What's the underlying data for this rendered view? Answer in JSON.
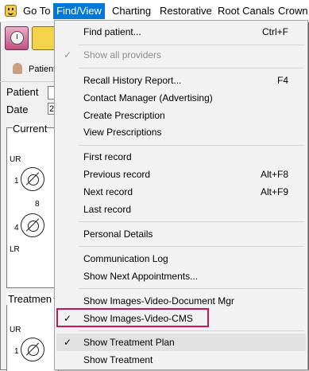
{
  "menubar": {
    "items": [
      {
        "label": "Go To"
      },
      {
        "label": "Find/View"
      },
      {
        "label": "Charting"
      },
      {
        "label": "Restorative"
      },
      {
        "label": "Root Canals"
      },
      {
        "label": "Crown"
      }
    ]
  },
  "background": {
    "patient_button": "Patient",
    "fields": {
      "patient_label": "Patient",
      "date_label": "Date",
      "date_value": "2"
    },
    "current_panel": {
      "title": "Current",
      "ur": "UR",
      "lr": "LR",
      "num1": "1",
      "num8": "8",
      "num4": "4"
    },
    "treatment_panel": {
      "title": "Treatmen",
      "ur": "UR",
      "num1": "1"
    }
  },
  "dropdown": {
    "items": [
      {
        "label": "Find patient...",
        "shortcut": "Ctrl+F",
        "checked": false,
        "disabled": false
      },
      {
        "label": "Show all providers",
        "shortcut": "",
        "checked": true,
        "disabled": true
      },
      {
        "label": "Recall History Report...",
        "shortcut": "F4",
        "checked": false,
        "disabled": false
      },
      {
        "label": "Contact Manager (Advertising)",
        "shortcut": "",
        "checked": false,
        "disabled": false
      },
      {
        "label": "Create Prescription",
        "shortcut": "",
        "checked": false,
        "disabled": false
      },
      {
        "label": "View Prescriptions",
        "shortcut": "",
        "checked": false,
        "disabled": false
      },
      {
        "label": "First record",
        "shortcut": "",
        "checked": false,
        "disabled": false
      },
      {
        "label": "Previous record",
        "shortcut": "Alt+F8",
        "checked": false,
        "disabled": false
      },
      {
        "label": "Next record",
        "shortcut": "Alt+F9",
        "checked": false,
        "disabled": false
      },
      {
        "label": "Last record",
        "shortcut": "",
        "checked": false,
        "disabled": false
      },
      {
        "label": "Personal Details",
        "shortcut": "",
        "checked": false,
        "disabled": false
      },
      {
        "label": "Communication Log",
        "shortcut": "",
        "checked": false,
        "disabled": false
      },
      {
        "label": "Show Next Appointments...",
        "shortcut": "",
        "checked": false,
        "disabled": false
      },
      {
        "label": "Show Images-Video-Document Mgr",
        "shortcut": "",
        "checked": false,
        "disabled": false
      },
      {
        "label": "Show Images-Video-CMS",
        "shortcut": "",
        "checked": true,
        "disabled": false
      },
      {
        "label": "Show Treatment Plan",
        "shortcut": "",
        "checked": true,
        "disabled": false
      },
      {
        "label": "Show Treatment",
        "shortcut": "",
        "checked": false,
        "disabled": false
      }
    ],
    "check_glyph": "✓"
  },
  "colors": {
    "menu_active": "#0078d7",
    "callout": "#c2185b",
    "highlight": "#e1e1e1"
  }
}
